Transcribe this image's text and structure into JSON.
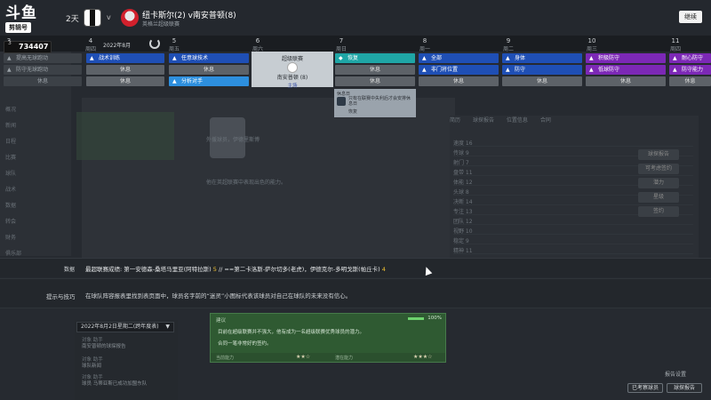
{
  "header": {
    "logo_text": "斗鱼",
    "logo_tag": "剪辑号",
    "days": "2天",
    "vs": "v",
    "match_title": "纽卡斯尔(2) v南安普顿(8)",
    "match_subtitle": "英格兰超级联赛",
    "continue_label": "继续"
  },
  "calendar": {
    "month": "2022年8月",
    "coins": "734407",
    "coins_prefix": "3",
    "days": [
      {
        "num": "3",
        "name": "周三"
      },
      {
        "num": "4",
        "name": "周四"
      },
      {
        "num": "5",
        "name": "周五"
      },
      {
        "num": "6",
        "name": "周六"
      },
      {
        "num": "7",
        "name": "周日"
      },
      {
        "num": "8",
        "name": "周一"
      },
      {
        "num": "9",
        "name": "周二"
      },
      {
        "num": "10",
        "name": "周三"
      },
      {
        "num": "11",
        "name": "周四"
      }
    ]
  },
  "schedule": {
    "col0": [
      "提高无球跑动",
      "防守无球跑动",
      "休息"
    ],
    "col1": [
      "战术训练",
      "休息",
      "休息"
    ],
    "col2": [
      "任意球技术",
      "休息",
      "分析对手"
    ],
    "col4": [
      "恢复",
      "休息",
      "休息"
    ],
    "col5": [
      "全部",
      "非门将位置",
      "休息"
    ],
    "col6": [
      "身体",
      "防守",
      "休息"
    ],
    "col7": [
      "积极防守",
      "低球防守",
      "休息"
    ],
    "col8": [
      "耐心防守",
      "防守能力",
      "休息"
    ],
    "match_card": {
      "comp": "超级联赛",
      "teams": "南安普顿 (8)",
      "venue": "主场"
    },
    "popup": {
      "type": "休息日",
      "text": "只有在联赛中失利后才会安排休息日",
      "action": "恢复"
    }
  },
  "background": {
    "nav_items": [
      "概况",
      "新闻",
      "日程",
      "比赛",
      "球队",
      "战术",
      "数据",
      "转会",
      "财务",
      "俱乐部"
    ],
    "tabs": [
      "简历",
      "球探报告",
      "位置信息",
      "合同"
    ],
    "rows": [
      "速度 16",
      "传球 9",
      "射门 7",
      "盘带 11",
      "体能 12",
      "头球 8",
      "决断 14",
      "专注 13",
      "团队 12",
      "视野 10",
      "稳定 9",
      "精神 11"
    ],
    "right_buttons": [
      "球探报告",
      "可考虑签约",
      "潜力",
      "星级",
      "签约"
    ],
    "profile_text": [
      "外援球员，伊德里斯博",
      "他在英超联赛中表现出色的能力。"
    ]
  },
  "data_row": {
    "label": "数据",
    "prefix": "最超联赛成绩: 第一安德森-桑塔马里亚(阿特拉斯)",
    "v1": "5",
    "middle": " // ==第二卡洛斯-萨尔切多(老虎)，伊德克尔-多明戈斯(帕丘卡)",
    "v2": "4"
  },
  "tips_row": {
    "label": "提示与技巧",
    "text": "在球队阵容报表里找到表页面中，球员名字前的“迷灵”小图标代表该球员对自己在球队的未来没有信心。"
  },
  "news": {
    "date_label": "2022年8月2日星期二(跨年度表)",
    "items": [
      {
        "head": "对象 助手",
        "body": "南安普顿的球探报告"
      },
      {
        "head": "对象 助手",
        "body": "球队新闻"
      },
      {
        "head": "对象 助手",
        "body": "球员 马蒂亚斯已成功加盟东队"
      }
    ]
  },
  "advice": {
    "label": "建议",
    "percent": "100%",
    "line1": "目前在超级联赛并不强大，他有成为一名超级联赛优秀球员的潜力。",
    "line2": "合同一笔非常好的签约。",
    "foot_left": "当前能力",
    "stars_left": "★★☆",
    "foot_right": "潜在能力",
    "stars_right": "★★★☆"
  },
  "bottom": {
    "report_link": "报告设置",
    "btn_consider": "已考察球员",
    "btn_report": "球探报告"
  },
  "colors": {
    "blue": "#1f4fb5",
    "lightblue": "#2d8fde",
    "teal": "#1fa6a6",
    "purple": "#7c28b6",
    "highlight": "#f2c230",
    "advice_green": "#2f5a32"
  }
}
